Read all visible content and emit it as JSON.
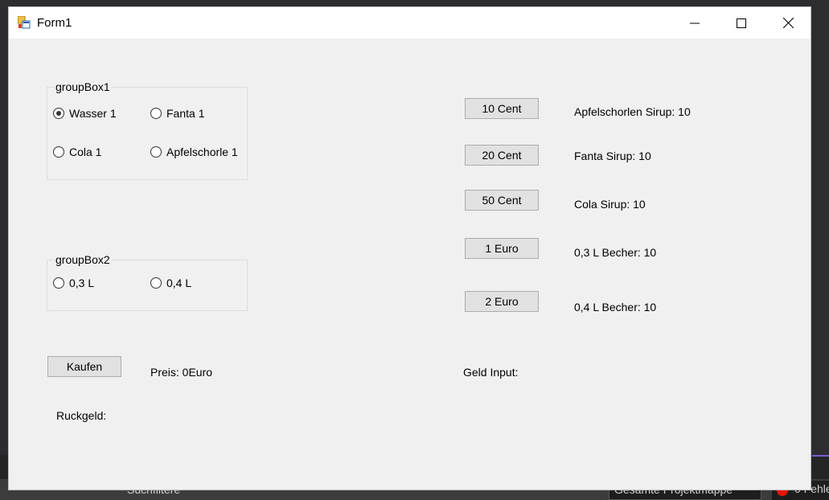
{
  "ide": {
    "search_text": "Suchfiltere",
    "scope_text": "Gesamte Projektmappe",
    "errors_text": "0 Fehle"
  },
  "window": {
    "title": "Form1"
  },
  "groupbox1": {
    "title": "groupBox1",
    "options": [
      {
        "label": "Wasser 1",
        "checked": true
      },
      {
        "label": "Fanta 1",
        "checked": false
      },
      {
        "label": "Cola 1",
        "checked": false
      },
      {
        "label": "Apfelschorle 1",
        "checked": false
      }
    ]
  },
  "groupbox2": {
    "title": "groupBox2",
    "options": [
      {
        "label": "0,3 L",
        "checked": false
      },
      {
        "label": "0,4 L",
        "checked": false
      }
    ]
  },
  "coin_buttons": [
    "10 Cent",
    "20 Cent",
    "50 Cent",
    "1 Euro",
    "2 Euro"
  ],
  "stock_labels": [
    "Apfelschorlen Sirup: 10",
    "Fanta Sirup: 10",
    "Cola Sirup: 10",
    "0,3 L Becher: 10",
    "0,4 L Becher: 10"
  ],
  "kaufen_label": "Kaufen",
  "preis_label": "Preis: 0Euro",
  "geld_input_label": "Geld Input:",
  "ruckgeld_label": "Ruckgeld:"
}
